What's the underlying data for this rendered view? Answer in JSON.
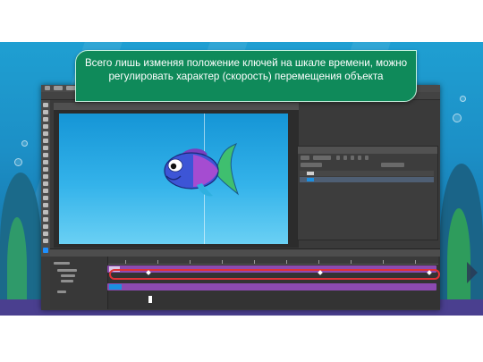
{
  "caption": {
    "text": "Всего лишь изменяя положение ключей на шкале времени, можно регулировать характер (скорость) перемещения объекта"
  },
  "colors": {
    "caption_bg": "#0f8a5a",
    "selection_outline": "#e03236",
    "track_purple": "#8c4ab0",
    "canvas_blue": "#1595d6"
  },
  "icons": {
    "fish": "fish-illustration",
    "next_slide": "chevron-right-icon"
  }
}
